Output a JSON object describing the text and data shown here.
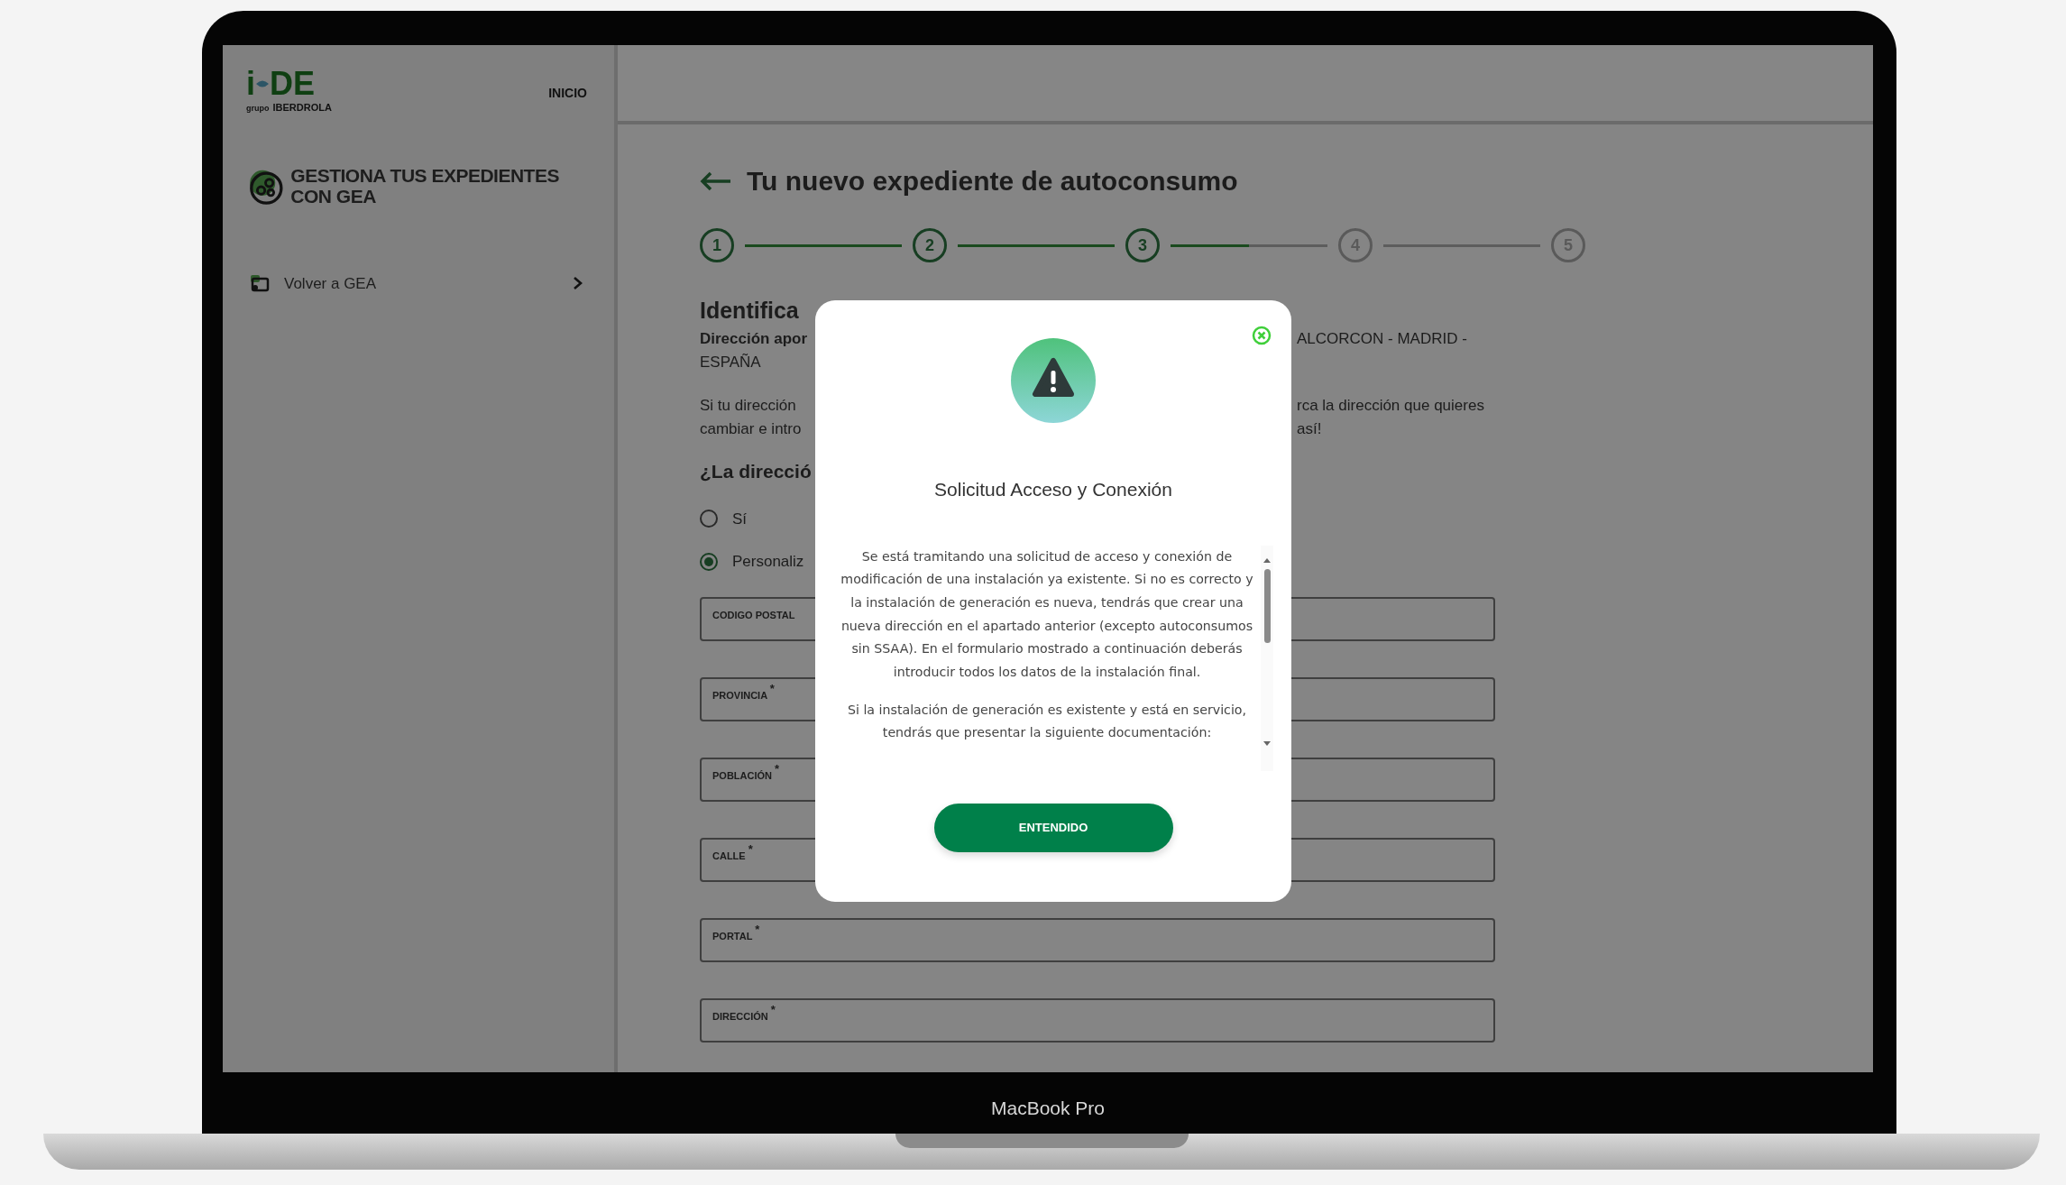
{
  "device_label": "MacBook Pro",
  "sidebar": {
    "logo": {
      "left": "i",
      "right": "DE",
      "tagline_prefix": "grupo",
      "tagline": "IBERDROLA"
    },
    "nav_link": "INICIO",
    "section_title": "GESTIONA TUS EXPEDIENTES CON GEA",
    "items": [
      {
        "label": "Volver a GEA"
      }
    ]
  },
  "main": {
    "title": "Tu nuevo expediente de autoconsumo",
    "steps": [
      {
        "label": "1",
        "completed": true
      },
      {
        "label": "2",
        "completed": true
      },
      {
        "label": "3",
        "completed": true
      },
      {
        "label": "4",
        "completed": false
      },
      {
        "label": "5",
        "completed": false
      }
    ],
    "connectors": [
      {
        "level": 1
      },
      {
        "level": 1
      },
      {
        "level": 0.5
      },
      {
        "level": 0
      }
    ],
    "section_heading": "Identifica",
    "address": {
      "label": "Dirección apor",
      "value_part": "ALCORCON - MADRID -",
      "value_line2": "ESPAÑA"
    },
    "note_lines": [
      {
        "left": "Si tu dirección",
        "right": "rca la dirección que quieres"
      },
      {
        "left": "cambiar e intro",
        "right": "así!"
      }
    ],
    "question": "¿La direcció",
    "radios": [
      {
        "label": "Sí",
        "selected": false
      },
      {
        "label": "Personaliz",
        "selected": true
      }
    ],
    "fields": [
      {
        "label": "CODIGO POSTAL"
      },
      {
        "label": "PROVINCIA $^{*}$"
      },
      {
        "label": "POBLACIÓN $^{*}$"
      },
      {
        "label": "CALLE $^{*}$"
      },
      {
        "label": "PORTAL $^{*}$"
      },
      {
        "label": "DIRECCIÓN $^{*}$"
      }
    ]
  },
  "modal": {
    "title": "Solicitud Acceso y Conexión",
    "paragraphs": [
      "Se está tramitando una solicitud de acceso y conexión de modificación de una instalación ya existente. Si no es correcto y la instalación de generación es nueva, tendrás que crear una nueva dirección en el apartado anterior (excepto autoconsumos sin SSAA). En el formulario mostrado a continuación deberás introducir todos los datos de la instalación final.",
      "Si la instalación de generación es existente y está en servicio, tendrás que presentar la siguiente documentación:"
    ],
    "button": "ENTENDIDO"
  }
}
